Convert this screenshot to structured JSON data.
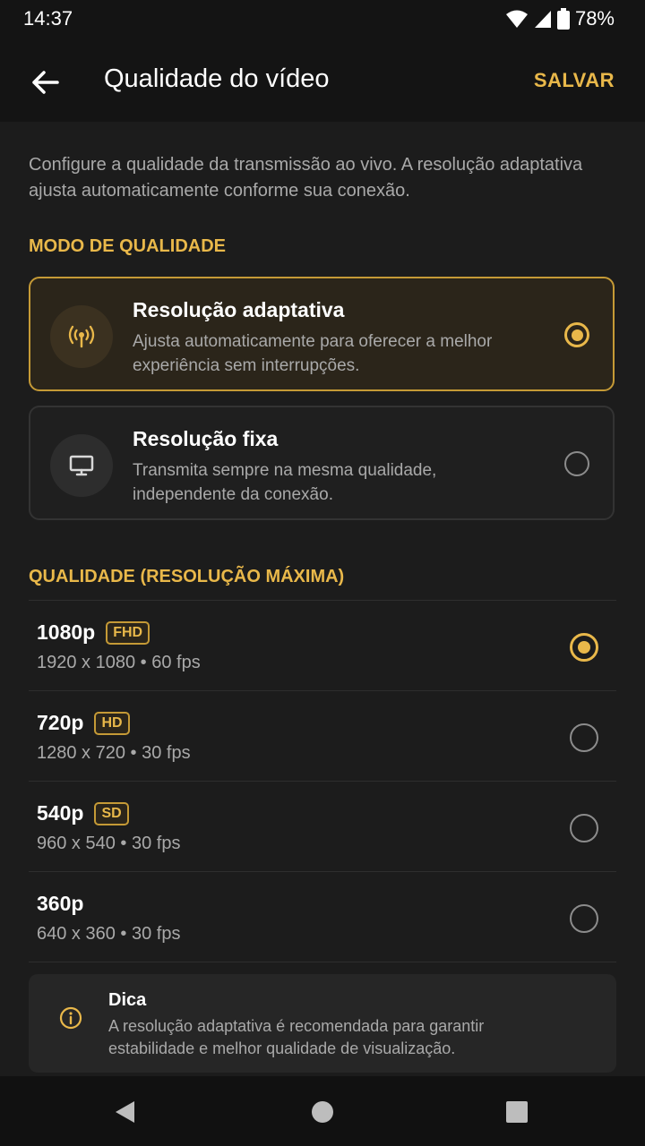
{
  "status": {
    "time": "14:37",
    "battery": "78%"
  },
  "appbar": {
    "title": "Qualidade do vídeo",
    "save_label": "SALVAR"
  },
  "description": "Configure a qualidade da transmissão ao vivo. A resolução adaptativa ajusta automaticamente conforme sua conexão.",
  "mode_section": {
    "title": "MODO DE QUALIDADE",
    "options": [
      {
        "title": "Resolução adaptativa",
        "subtitle": "Ajusta automaticamente para oferecer a melhor experiência sem interrupções.",
        "icon": "broadcast-icon",
        "selected": true
      },
      {
        "title": "Resolução fixa",
        "subtitle": "Transmita sempre na mesma qualidade, independente da conexão.",
        "icon": "monitor-icon",
        "selected": false
      }
    ]
  },
  "quality_section": {
    "title": "QUALIDADE (RESOLUÇÃO MÁXIMA)",
    "options": [
      {
        "name": "1080p",
        "badge": "FHD",
        "spec": "1920 x 1080 • 60 fps",
        "selected": true
      },
      {
        "name": "720p",
        "badge": "HD",
        "spec": "1280 x 720 • 30 fps",
        "selected": false
      },
      {
        "name": "540p",
        "badge": "SD",
        "spec": "960 x 540 • 30 fps",
        "selected": false
      },
      {
        "name": "360p",
        "badge": "",
        "spec": "640 x 360 • 30 fps",
        "selected": false
      }
    ]
  },
  "tip": {
    "title": "Dica",
    "text": "A resolução adaptativa é recomendada para garantir estabilidade e melhor qualidade de visualização."
  },
  "colors": {
    "accent": "#e9b84a",
    "background": "#1c1c1c",
    "bar": "#141414"
  }
}
